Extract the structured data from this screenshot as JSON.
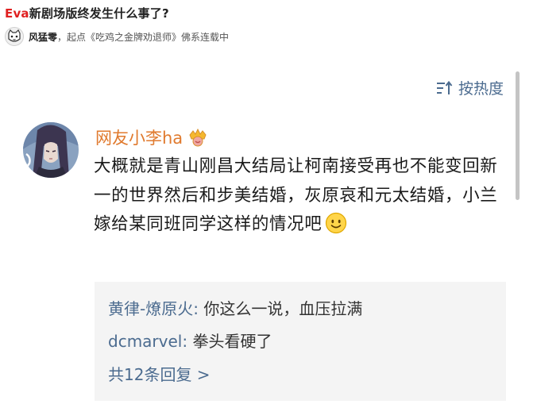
{
  "question": {
    "title_highlight": "Eva",
    "title_rest": "新剧场版终发生什么事了?"
  },
  "author": {
    "name": "风猛零",
    "description": "，起点《吃鸡之金牌劝退师》佛系连载中"
  },
  "sort": {
    "label": "按热度",
    "icon": "sort-icon"
  },
  "comment": {
    "username": "网友小李ha",
    "badge_icon": "crown-badge-icon",
    "text": "大概就是青山刚昌大结局让柯南接受再也不能变回新一的世界然后和步美结婚，灰原哀和元太结婚，小兰嫁给某同班同学这样的情况吧",
    "emoji": "smile-emoji-icon"
  },
  "replies": [
    {
      "name": "黄律-燎原火",
      "separator": ": ",
      "text": "你这么一说，血压拉满"
    },
    {
      "name": "dcmarvel",
      "separator": ": ",
      "text": "拳头看硬了"
    }
  ],
  "more_replies": "共12条回复 >",
  "colors": {
    "link_blue": "#4b6b8f",
    "username_orange": "#e07a2e",
    "title_red": "#e02020",
    "reply_bg": "#f4f4f4"
  }
}
